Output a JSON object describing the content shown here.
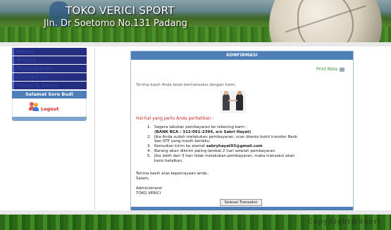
{
  "header": {
    "store_name": "TOKO VERICI SPORT",
    "address": "Jln. Dr Soetomo No.131 Padang"
  },
  "sidebar": {
    "items": [
      {
        "label": "Home"
      },
      {
        "label": "Produk"
      },
      {
        "label": "Pembayaran"
      },
      {
        "label": "Contact Us"
      },
      {
        "label": "Pesan & Saran"
      }
    ],
    "greeting": "Selamat Sore Budi",
    "logout_label": "Logout"
  },
  "panel": {
    "title": "KONFIRMASI",
    "print_label": "Print Nota",
    "thanks": "Terima kasih Anda telah bertransaksi dengan kami,",
    "notice_title": "Hal-hal yang perlu Anda perhatikan :",
    "instructions": [
      {
        "num": "1.",
        "l1": "Segera lakukan pembayaran ke rekening kami :",
        "l2": "(BANK BCA : 312-061-2394, a/o Sabri Hayat)"
      },
      {
        "num": "2.",
        "l1": "Jika Anda sudah melakukan pembayaran, scan blanko bukti transfer Bank",
        "l2": "dan KTP yang masih berlaku."
      },
      {
        "num": "3.",
        "pre": "Kemudian kirim ke alamat ",
        "email": "sabryhayat93@gmail.com"
      },
      {
        "num": "4.",
        "l1": "Barang akan dikirim paling lambat 2 hari setelah pembayaran."
      },
      {
        "num": "5.",
        "l1": "Jika lebih dari 3 hari tidak melakukan pembayaran, maka transaksi akan",
        "l2": "kami batalkan."
      }
    ],
    "closing_line1": "Terima kasih atas kepercayaan anda..",
    "closing_line2": "Salam,",
    "sign_role": "Administraror",
    "sign_name": "TOKO VERICI",
    "done_button": "Selesai Transaksi"
  },
  "footer": {
    "copyright": "CopyRight@Sabri"
  }
}
